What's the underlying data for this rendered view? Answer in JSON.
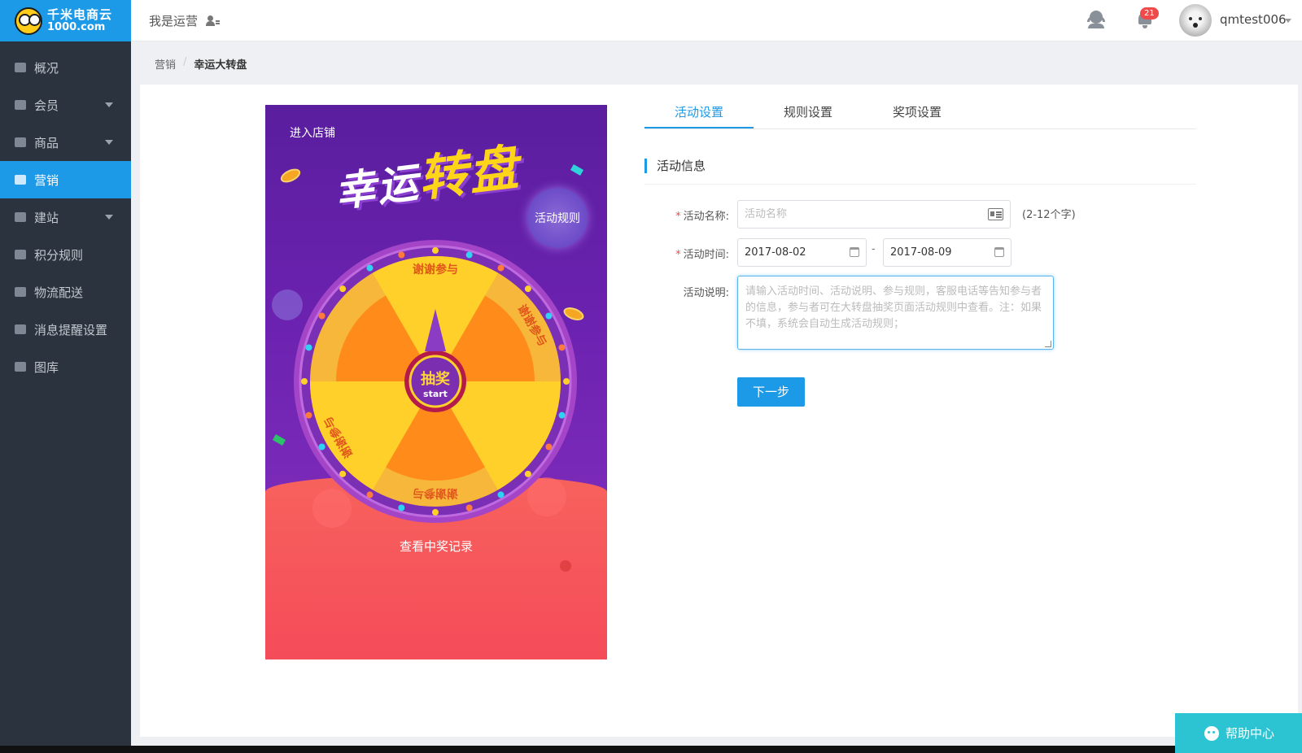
{
  "logo": {
    "name": "千米电商云",
    "domain": "1000.com"
  },
  "sidebar": {
    "items": [
      {
        "label": "概况",
        "expandable": false,
        "active": false,
        "icon": "chart-icon"
      },
      {
        "label": "会员",
        "expandable": true,
        "active": false,
        "icon": "user-icon"
      },
      {
        "label": "商品",
        "expandable": true,
        "active": false,
        "icon": "bag-icon"
      },
      {
        "label": "营销",
        "expandable": false,
        "active": true,
        "icon": "marketing-icon"
      },
      {
        "label": "建站",
        "expandable": true,
        "active": false,
        "icon": "monitor-icon"
      },
      {
        "label": "积分规则",
        "expandable": false,
        "active": false,
        "icon": "database-icon"
      },
      {
        "label": "物流配送",
        "expandable": false,
        "active": false,
        "icon": "truck-icon"
      },
      {
        "label": "消息提醒设置",
        "expandable": false,
        "active": false,
        "icon": "alert-icon"
      },
      {
        "label": "图库",
        "expandable": false,
        "active": false,
        "icon": "image-icon"
      }
    ]
  },
  "header": {
    "role": "我是运营",
    "notifications": "21",
    "username": "qmtest006"
  },
  "breadcrumb": {
    "parent": "营销",
    "current": "幸运大转盘"
  },
  "preview": {
    "enter_shop": "进入店铺",
    "title_a": "幸运",
    "title_b": "转盘",
    "rules_button": "活动规则",
    "wheel_segments": [
      "谢谢参与",
      "谢谢参与",
      "谢谢参与",
      "谢谢参与"
    ],
    "center_label": "抽奖",
    "center_sub": "start",
    "records_link": "查看中奖记录"
  },
  "tabs": [
    {
      "label": "活动设置",
      "active": true
    },
    {
      "label": "规则设置",
      "active": false
    },
    {
      "label": "奖项设置",
      "active": false
    }
  ],
  "form": {
    "section_title": "活动信息",
    "name_label": "活动名称:",
    "name_placeholder": "活动名称",
    "name_hint": "(2-12个字)",
    "time_label": "活动时间:",
    "start_date": "2017-08-02",
    "date_separator": "-",
    "end_date": "2017-08-09",
    "desc_label": "活动说明:",
    "desc_placeholder": "请输入活动时间、活动说明、参与规则，客服电话等告知参与者的信息，参与者可在大转盘抽奖页面活动规则中查看。注：如果不填，系统会自动生成活动规则；",
    "next_button": "下一步"
  },
  "help": {
    "label": "帮助中心"
  },
  "colors": {
    "accent": "#1c9ae8",
    "sidebar": "#2b333e",
    "help": "#2cc4d3",
    "wheel_purple": "#6c22b0",
    "wheel_red": "#f54b5a"
  }
}
